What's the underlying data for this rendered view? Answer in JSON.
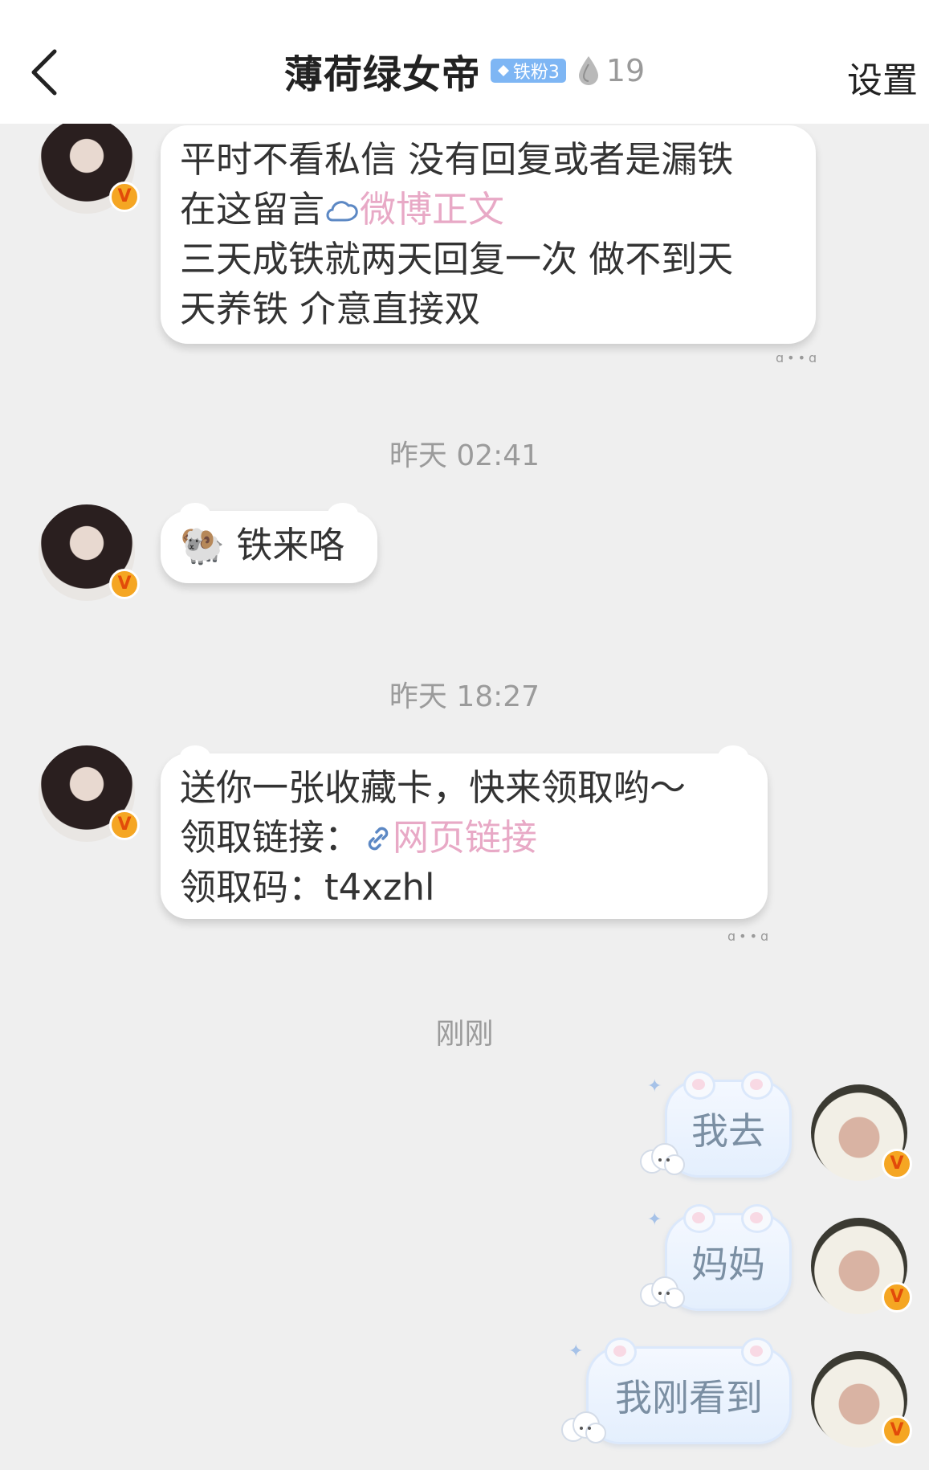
{
  "header": {
    "title": "薄荷绿女帝",
    "fan_badge": "铁粉3",
    "fire_count": "19",
    "settings_label": "设置"
  },
  "messages": {
    "m1_line1": "平时不看私信 没有回复或者是漏铁",
    "m1_line2_prefix": "在这留言",
    "m1_link": "微博正文",
    "m1_line3": "三天成铁就两天回复一次 做不到天",
    "m1_line4": "天养铁 介意直接双",
    "ts1": "昨天 02:41",
    "m2_emoji": "🐏",
    "m2_text": "铁来咯",
    "ts2": "昨天 18:27",
    "m3_line1": "送你一张收藏卡，快来领取哟～",
    "m3_line2_prefix": "领取链接：",
    "m3_link": "网页链接",
    "m3_line3": "领取码：t4xzhl",
    "ts3": "刚刚",
    "me1": "我去",
    "me2": "妈妈",
    "me3": "我刚看到"
  },
  "colors": {
    "link": "#e8a9c6",
    "fan_badge_bg": "#7eb6f4",
    "verified_badge": "#f5a623"
  },
  "icons": {
    "back": "chevron-left-icon",
    "drop": "drop-icon",
    "weibo_link": "weibo-logo-icon",
    "web_link": "link-icon",
    "verified": "verified-v-icon"
  }
}
